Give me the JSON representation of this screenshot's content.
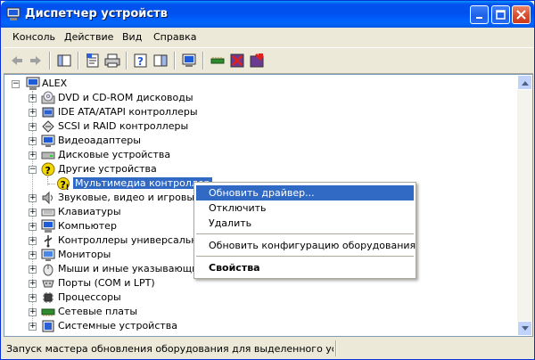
{
  "window": {
    "title": "Диспетчер устройств"
  },
  "menubar": [
    "Консоль",
    "Действие",
    "Вид",
    "Справка"
  ],
  "toolbar": {
    "icons": [
      "back-icon",
      "forward-icon",
      "show-hide-tree-icon",
      "properties-icon",
      "print-icon",
      "help-icon",
      "show-hide-action-pane-icon",
      "scan-hardware-icon",
      "update-driver-icon",
      "disable-device-icon",
      "uninstall-device-icon"
    ]
  },
  "tree": {
    "root": "ALEX",
    "items": [
      {
        "label": "DVD и CD-ROM дисководы",
        "expanded": false
      },
      {
        "label": "IDE ATA/ATAPI контроллеры",
        "expanded": false
      },
      {
        "label": "SCSI и RAID контроллеры",
        "expanded": false
      },
      {
        "label": "Видеоадаптеры",
        "expanded": false
      },
      {
        "label": "Дисковые устройства",
        "expanded": false
      },
      {
        "label": "Другие устройства",
        "expanded": true
      },
      {
        "label": "Мультимедиа контроллер",
        "child": true,
        "selected": true
      },
      {
        "label": "Звуковые, видео и игровые устройства",
        "expanded": false
      },
      {
        "label": "Клавиатуры",
        "expanded": false
      },
      {
        "label": "Компьютер",
        "expanded": false
      },
      {
        "label": "Контроллеры универсальной последовательной шины USB",
        "expanded": false
      },
      {
        "label": "Мониторы",
        "expanded": false
      },
      {
        "label": "Мыши и иные указывающие устройства",
        "expanded": false
      },
      {
        "label": "Порты (COM и LPT)",
        "expanded": false
      },
      {
        "label": "Процессоры",
        "expanded": false
      },
      {
        "label": "Сетевые платы",
        "expanded": false
      },
      {
        "label": "Системные устройства",
        "expanded": false
      }
    ]
  },
  "context_menu": {
    "items": [
      "Обновить драйвер...",
      "Отключить",
      "Удалить",
      "Обновить конфигурацию оборудования",
      "Свойства"
    ]
  },
  "status": {
    "text": "Запуск мастера обновления оборудования для выделенного устройства."
  },
  "colors": {
    "titlebar": "#0058e6",
    "selection": "#316ac5",
    "window_bg": "#ece9d8"
  }
}
